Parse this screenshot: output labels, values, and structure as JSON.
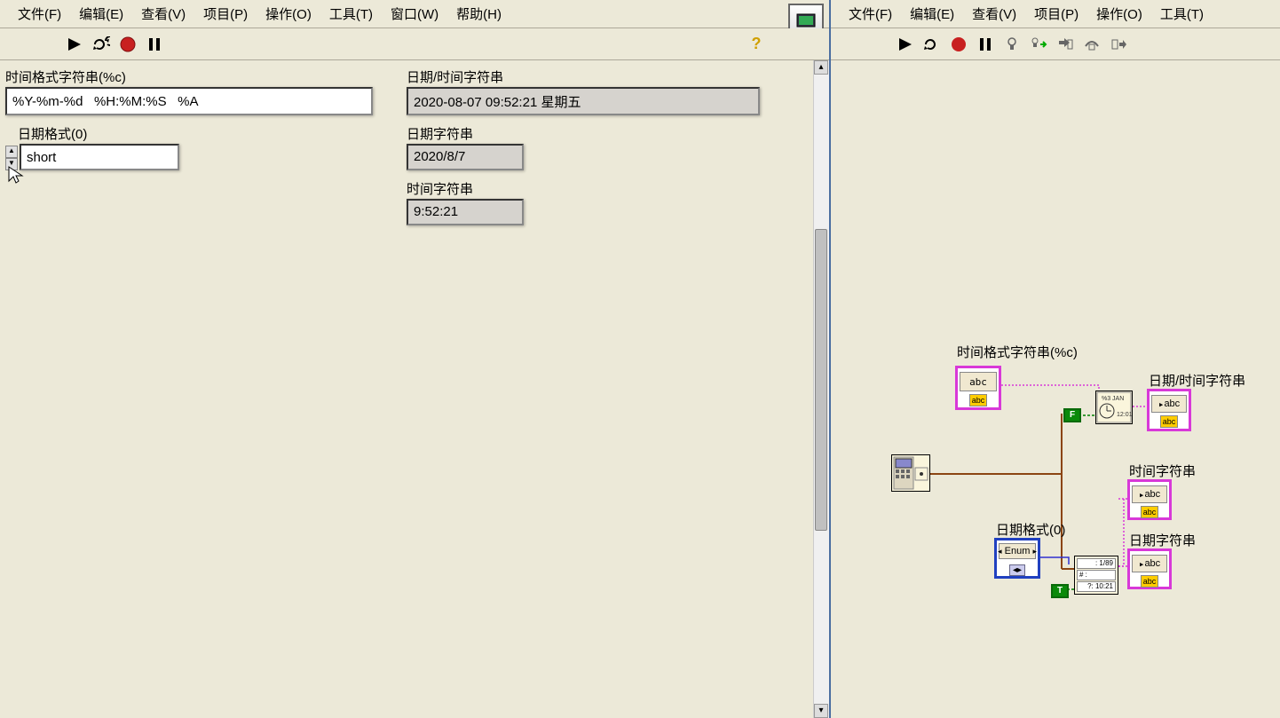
{
  "menubar": {
    "items": [
      "文件(F)",
      "编辑(E)",
      "查看(V)",
      "项目(P)",
      "操作(O)",
      "工具(T)",
      "窗口(W)",
      "帮助(H)"
    ]
  },
  "menubar_right": {
    "items": [
      "文件(F)",
      "编辑(E)",
      "查看(V)",
      "项目(P)",
      "操作(O)",
      "工具(T)"
    ]
  },
  "front_panel": {
    "labels": {
      "time_format_string": "时间格式字符串(%c)",
      "datetime_string": "日期/时间字符串",
      "date_format": "日期格式(0)",
      "date_string": "日期字符串",
      "time_string": "时间字符串"
    },
    "values": {
      "time_format_string": "%Y-%m-%d   %H:%M:%S   %A",
      "datetime_string": "2020-08-07   09:52:21   星期五",
      "date_format": "short",
      "date_string": "2020/8/7",
      "time_string": "9:52:21"
    }
  },
  "block_diagram": {
    "labels": {
      "time_format_string": "时间格式字符串(%c)",
      "datetime_string": "日期/时间字符串",
      "time_string": "时间字符串",
      "date_format": "日期格式(0)",
      "date_string": "日期字符串"
    },
    "node_text": {
      "abc": "abc",
      "enum": "Enum",
      "bool_t": "T",
      "bool_f": "F",
      "date_node": "1/89",
      "time_node": "10:21"
    }
  },
  "toolbar": {
    "help": "?"
  }
}
